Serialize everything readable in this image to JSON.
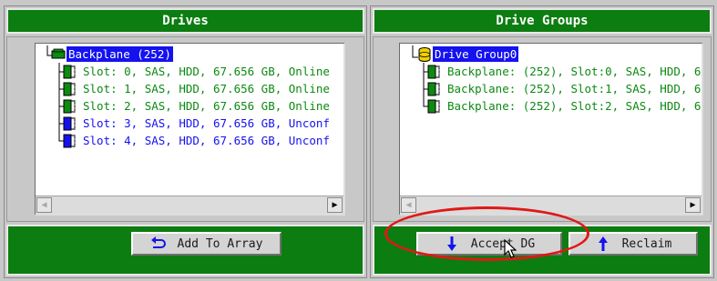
{
  "left_panel": {
    "title": "Drives",
    "tree": [
      {
        "label": "Backplane (252)",
        "selected": true,
        "kind": "backplane",
        "icon": "backplane-icon"
      },
      {
        "label": "Slot: 0, SAS, HDD, 67.656 GB, Online",
        "color": "green",
        "icon": "drive-online-icon"
      },
      {
        "label": "Slot: 1, SAS, HDD, 67.656 GB, Online",
        "color": "green",
        "icon": "drive-online-icon"
      },
      {
        "label": "Slot: 2, SAS, HDD, 67.656 GB, Online",
        "color": "green",
        "icon": "drive-online-icon"
      },
      {
        "label": "Slot: 3, SAS, HDD, 67.656 GB, Unconf",
        "color": "blue",
        "icon": "drive-unconfigured-icon"
      },
      {
        "label": "Slot: 4, SAS, HDD, 67.656 GB, Unconf",
        "color": "blue",
        "icon": "drive-unconfigured-icon"
      }
    ],
    "button": {
      "label": "Add To Array",
      "icon": "undo-arrow-icon"
    }
  },
  "right_panel": {
    "title": "Drive Groups",
    "tree": [
      {
        "label": "Drive Group0",
        "selected": true,
        "kind": "group",
        "icon": "database-icon"
      },
      {
        "label": "Backplane: (252), Slot:0, SAS, HDD, 6",
        "color": "green",
        "icon": "drive-online-icon"
      },
      {
        "label": "Backplane: (252), Slot:1, SAS, HDD, 6",
        "color": "green",
        "icon": "drive-online-icon"
      },
      {
        "label": "Backplane: (252), Slot:2, SAS, HDD, 6",
        "color": "green",
        "icon": "drive-online-icon"
      }
    ],
    "buttons": [
      {
        "label": "Accept DG",
        "icon": "arrow-down-icon"
      },
      {
        "label": "Reclaim",
        "icon": "arrow-up-icon"
      }
    ]
  },
  "colors": {
    "header_green": "#0c7d10",
    "online_green": "#0c8a12",
    "selection_blue": "#1512f0",
    "annotation_red": "#e01818"
  }
}
